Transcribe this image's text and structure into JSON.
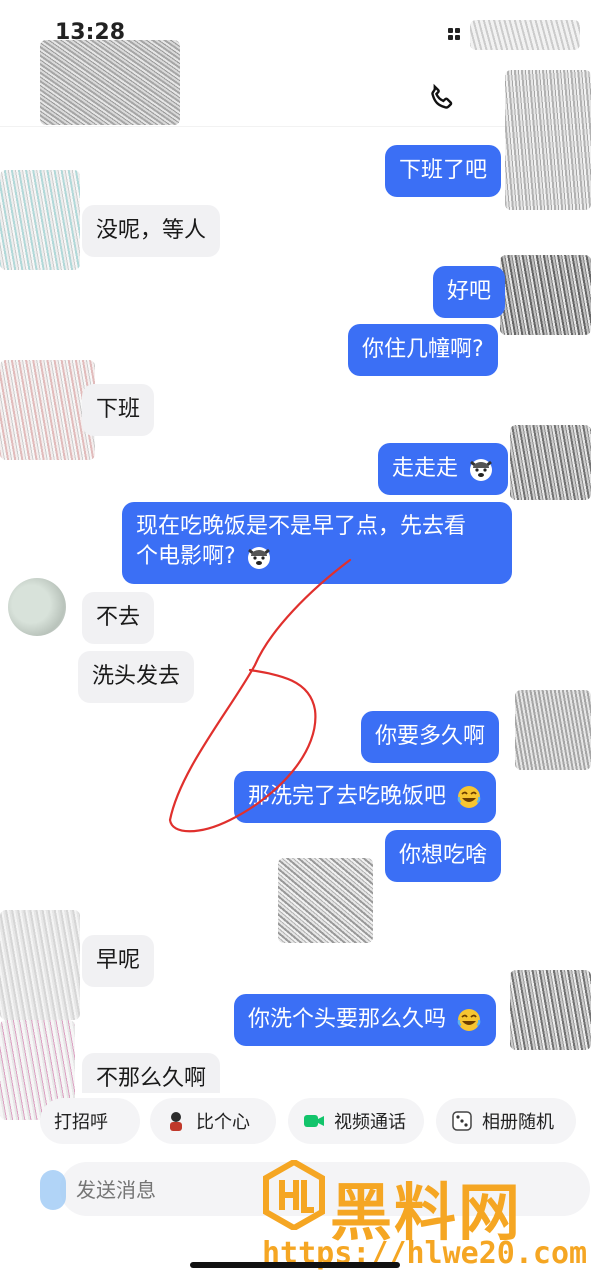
{
  "status": {
    "time": "13:28"
  },
  "messages": [
    {
      "side": "me",
      "text": "下班了吧"
    },
    {
      "side": "them",
      "text": "没呢，等人"
    },
    {
      "side": "me",
      "text": "好吧"
    },
    {
      "side": "me",
      "text": "你住几幢啊?"
    },
    {
      "side": "them",
      "text": "下班"
    },
    {
      "side": "me",
      "text": "走走走"
    },
    {
      "side": "me",
      "text": "现在吃晚饭是不是早了点，先去看",
      "text2": "个电影啊?"
    },
    {
      "side": "them",
      "text": "不去"
    },
    {
      "side": "them",
      "text": "洗头发去"
    },
    {
      "side": "me",
      "text": "你要多久啊"
    },
    {
      "side": "me",
      "text": "那洗完了去吃晚饭吧"
    },
    {
      "side": "me",
      "text": "你想吃啥"
    },
    {
      "side": "them",
      "text": "早呢"
    },
    {
      "side": "me",
      "text": "你洗个头要那么久吗"
    },
    {
      "side": "them",
      "text": "不那么久啊"
    }
  ],
  "quick_actions": [
    {
      "label": "打招呼",
      "icon": "wave-icon"
    },
    {
      "label": "比个心",
      "icon": "heart-gesture-icon"
    },
    {
      "label": "视频通话",
      "icon": "video-camera-icon"
    },
    {
      "label": "相册随机",
      "icon": "dice-icon"
    }
  ],
  "composer": {
    "placeholder": "发送消息"
  },
  "watermark": {
    "name": "黑料网",
    "url": "https://hlwe20.com"
  },
  "colors": {
    "my_bubble": "#3b6ff5",
    "their_bubble": "#f1f1f3",
    "watermark": "#f5a623"
  }
}
